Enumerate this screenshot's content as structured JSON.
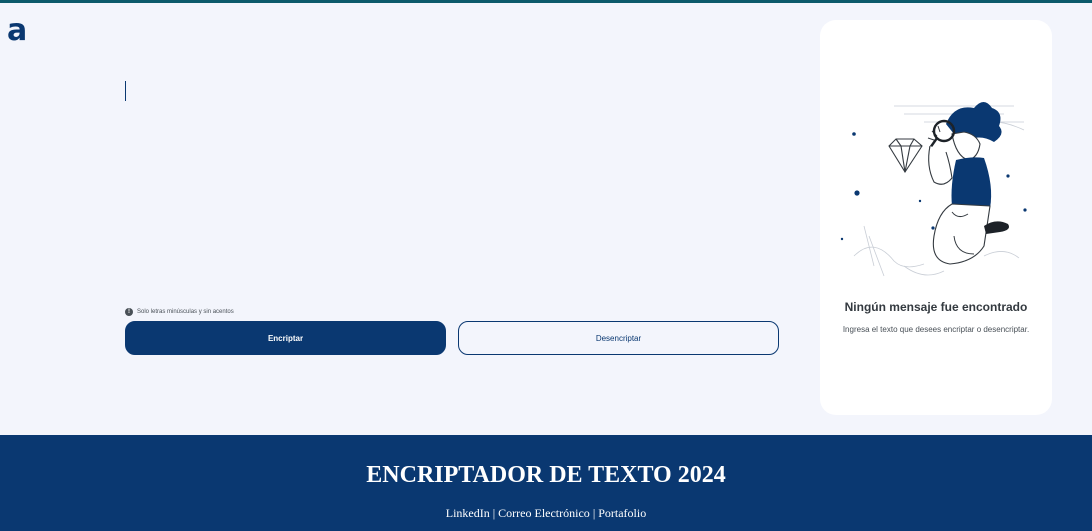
{
  "header": {
    "logo_text": "a",
    "accent_color": "#0c5a6b"
  },
  "editor": {
    "value": "",
    "hint_icon": "info-icon",
    "hint_text": "Solo letras minúsculas y sin acentos"
  },
  "buttons": {
    "encrypt_label": "Encriptar",
    "decrypt_label": "Desencriptar"
  },
  "panel": {
    "illustration": "person-with-magnifier-illustration",
    "title": "Ningún mensaje fue encontrado",
    "subtitle": "Ingresa el texto que desees encriptar o desencriptar."
  },
  "footer": {
    "title": "ENCRIPTADOR DE TEXTO 2024",
    "links": [
      "LinkedIn",
      "Correo Electrónico",
      "Portafolio"
    ],
    "separator": " | "
  },
  "colors": {
    "primary": "#0a3871",
    "background": "#f3f5fc",
    "panel": "#ffffff"
  }
}
